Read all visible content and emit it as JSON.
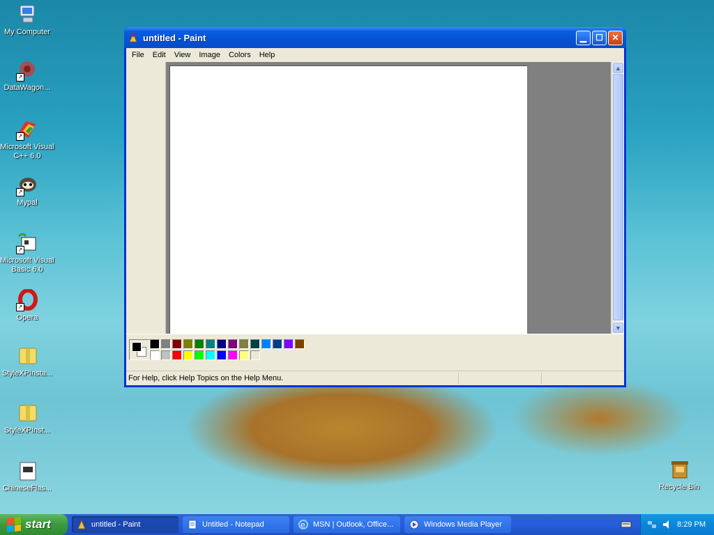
{
  "desktop": {
    "icons": [
      {
        "label": "My Computer",
        "icon": "my-computer-icon"
      },
      {
        "label": "DataWagon...",
        "icon": "datawagon-icon"
      },
      {
        "label": "Microsoft Visual C++ 6.0",
        "icon": "visual-cpp-icon"
      },
      {
        "label": "Mypal",
        "icon": "mypal-icon"
      },
      {
        "label": "Microsoft Visual Basic 6.0",
        "icon": "visual-basic-icon"
      },
      {
        "label": "Opera",
        "icon": "opera-icon"
      },
      {
        "label": "StyleXPInsta...",
        "icon": "stylexp-installer-icon"
      },
      {
        "label": "StyleXPInst...",
        "icon": "stylexp-installer-icon"
      },
      {
        "label": "ChineseFlas...",
        "icon": "chineseflash-icon"
      },
      {
        "label": "Recycle Bin",
        "icon": "recycle-bin-icon"
      }
    ]
  },
  "window": {
    "title": "untitled - Paint",
    "menu": [
      "File",
      "Edit",
      "View",
      "Image",
      "Colors",
      "Help"
    ],
    "status": "For Help, click Help Topics on the Help Menu.",
    "palette": {
      "foreground": "#000000",
      "background": "#ffffff",
      "top_row": [
        "#000000",
        "#808080",
        "#800000",
        "#808000",
        "#008000",
        "#008080",
        "#000080",
        "#800080",
        "#808040",
        "#004040",
        "#0080ff",
        "#004080",
        "#8000ff",
        "#804000"
      ],
      "bottom_row": [
        "#ffffff",
        "#c0c0c0",
        "#ff0000",
        "#ffff00",
        "#00ff00",
        "#00ffff",
        "#0000ff",
        "#ff00ff",
        "#ffff80",
        "#ece9d8"
      ]
    }
  },
  "taskbar": {
    "start_label": "start",
    "tasks": [
      {
        "label": "untitled - Paint",
        "icon": "paint-icon",
        "active": true
      },
      {
        "label": "Untitled - Notepad",
        "icon": "notepad-icon",
        "active": false
      },
      {
        "label": "MSN | Outlook, Office...",
        "icon": "ie-icon",
        "active": false
      },
      {
        "label": "Windows Media Player",
        "icon": "media-player-icon",
        "active": false
      }
    ],
    "clock": "8:29 PM"
  }
}
